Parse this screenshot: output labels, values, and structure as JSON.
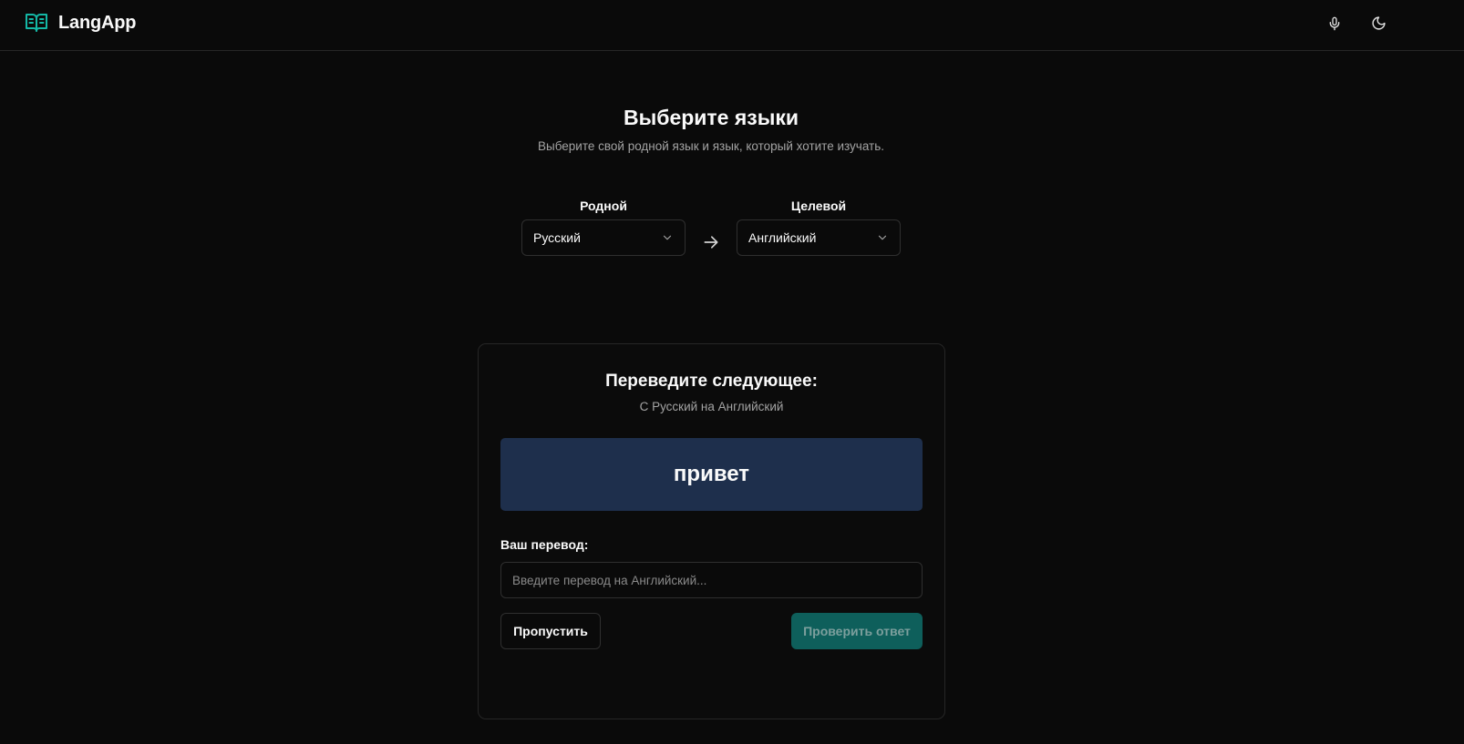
{
  "app": {
    "name": "LangApp",
    "logo_icon": "book-open-icon",
    "brand_color": "#14b8a6"
  },
  "header": {
    "mic_icon": "microphone-icon",
    "theme_icon": "moon-icon"
  },
  "language_picker": {
    "title": "Выберите языки",
    "subtitle": "Выберите свой родной язык и язык, который хотите изучать.",
    "native_label": "Родной",
    "native_value": "Русский",
    "target_label": "Целевой",
    "target_value": "Английский"
  },
  "exercise": {
    "title": "Переведите следующее:",
    "direction": "С Русский на Английский",
    "word": "привет",
    "word_box_color": "#1e2f4c",
    "answer_label": "Ваш перевод:",
    "answer_value": "",
    "answer_placeholder": "Введите перевод на Английский...",
    "skip_label": "Пропустить",
    "check_label": "Проверить ответ",
    "check_color": "#0e5f5b"
  }
}
